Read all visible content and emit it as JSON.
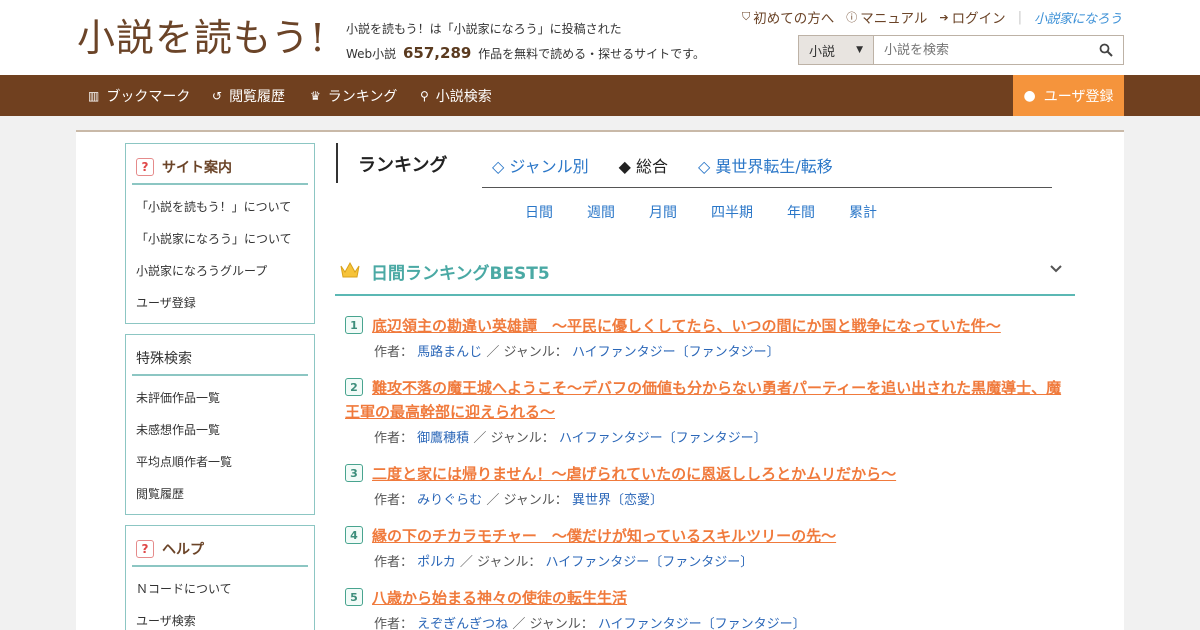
{
  "header": {
    "logo": "小説を読もう!",
    "tagline_line1": "小説を読もう！は「小説家になろう」に投稿された",
    "tagline_prefix": "Web小説",
    "tagline_count": "657,289",
    "tagline_suffix": "作品を無料で読める・探せるサイトです。",
    "top_links": [
      "初めての方へ",
      "マニュアル",
      "ログイン"
    ],
    "narou_logo": "小説家になろう",
    "search_select": "小説",
    "search_placeholder": "小説を検索"
  },
  "nav": {
    "items": [
      "ブックマーク",
      "閲覧履歴",
      "ランキング",
      "小説検索"
    ],
    "register": "ユーザ登録"
  },
  "sidebar": {
    "site_info": {
      "title": "サイト案内",
      "items": [
        "「小説を読もう！」について",
        "「小説家になろう」について",
        "小説家になろうグループ",
        "ユーザ登録"
      ]
    },
    "special_search": {
      "title": "特殊検索",
      "items": [
        "未評価作品一覧",
        "未感想作品一覧",
        "平均点順作者一覧",
        "閲覧履歴"
      ]
    },
    "help": {
      "title": "ヘルプ",
      "items": [
        "Ｎコードについて",
        "ユーザ検索"
      ]
    }
  },
  "ranking": {
    "title": "ランキング",
    "tabs": [
      "◇ ジャンル別",
      "◆ 総合",
      "◇ 異世界転生/転移"
    ],
    "periods": [
      "日間",
      "週間",
      "月間",
      "四半期",
      "年間",
      "累計"
    ],
    "best_title": "日間ランキングBEST5",
    "author_label": "作者：",
    "genre_label": "／ ジャンル：",
    "entries": [
      {
        "rank": "1",
        "title": "底辺領主の勘違い英雄譚　～平民に優しくしてたら、いつの間にか国と戦争になっていた件～",
        "author": "馬路まんじ",
        "genre": "ハイファンタジー〔ファンタジー〕"
      },
      {
        "rank": "2",
        "title": "難攻不落の魔王城へようこそ～デバフの価値も分からない勇者パーティーを追い出された黒魔導士、魔王軍の最高幹部に迎えられる～",
        "author": "御鷹穂積",
        "genre": "ハイファンタジー〔ファンタジー〕"
      },
      {
        "rank": "3",
        "title": "二度と家には帰りません！～虐げられていたのに恩返ししろとかムリだから～",
        "author": "みりぐらむ",
        "genre": "異世界〔恋愛〕"
      },
      {
        "rank": "4",
        "title": "縁の下のチカラモチャー　～僕だけが知っているスキルツリーの先～",
        "author": "ポルカ",
        "genre": "ハイファンタジー〔ファンタジー〕"
      },
      {
        "rank": "5",
        "title": "八歳から始まる神々の使徒の転生生活",
        "author": "えぞぎんぎつね",
        "genre": "ハイファンタジー〔ファンタジー〕"
      }
    ]
  },
  "colors": {
    "brown": "#70401f",
    "orange": "#f5943c",
    "teal": "#5bb8b4",
    "title_orange": "#f07a3c",
    "link_blue": "#2b77c8"
  }
}
